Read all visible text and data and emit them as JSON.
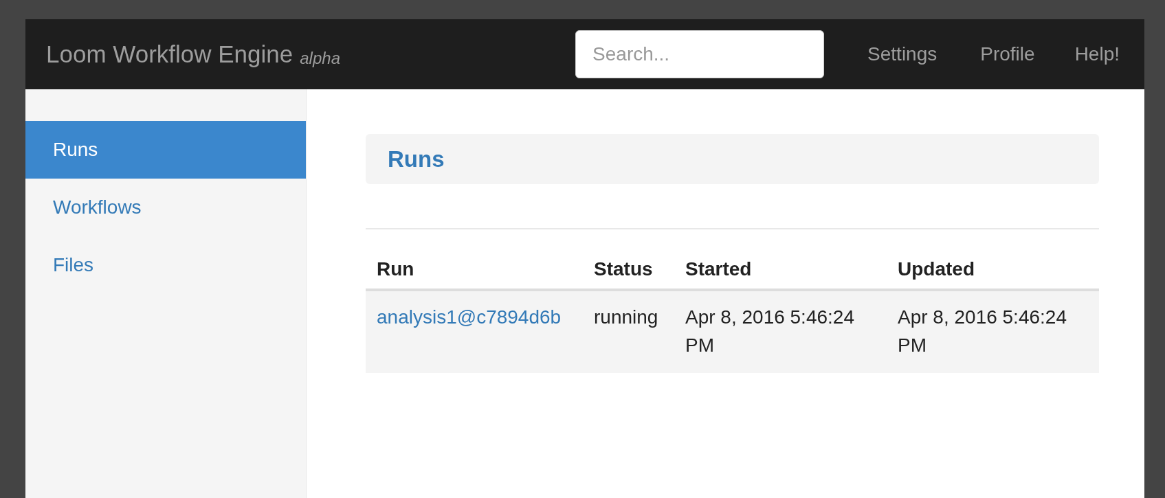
{
  "navbar": {
    "brand": "Loom Workflow Engine",
    "brand_tag": "alpha",
    "search": {
      "placeholder": "Search..."
    },
    "links": [
      "Settings",
      "Profile",
      "Help!"
    ]
  },
  "sidebar": {
    "items": [
      {
        "label": "Runs",
        "selected": true
      },
      {
        "label": "Workflows",
        "selected": false
      },
      {
        "label": "Files",
        "selected": false
      }
    ]
  },
  "main": {
    "heading": "Runs",
    "table": {
      "columns": [
        "Run",
        "Status",
        "Started",
        "Updated"
      ],
      "rows": [
        {
          "run": "analysis1@c7894d6b",
          "status": "running",
          "started": "Apr 8, 2016 5:46:24 PM",
          "updated": "Apr 8, 2016 5:46:24 PM"
        }
      ]
    }
  }
}
